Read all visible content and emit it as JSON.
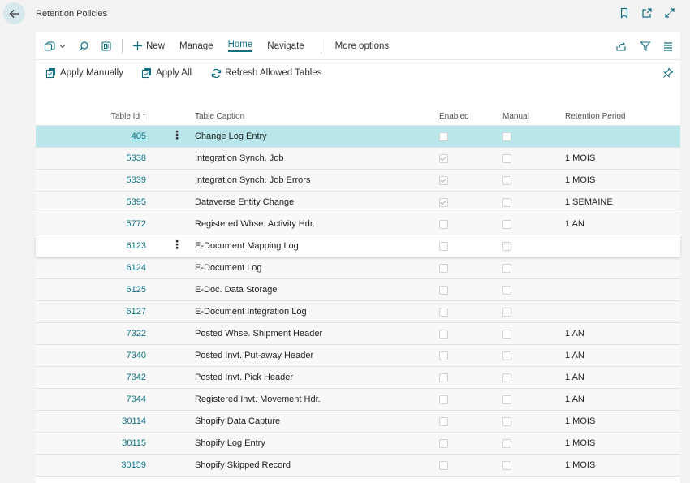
{
  "window": {
    "title": "Retention Policies"
  },
  "actions": {
    "new": "New",
    "manage": "Manage",
    "home": "Home",
    "navigate": "Navigate",
    "more": "More options"
  },
  "promoted": {
    "apply_manually": "Apply Manually",
    "apply_all": "Apply All",
    "refresh": "Refresh Allowed Tables"
  },
  "columns": {
    "table_id": "Table Id",
    "table_caption": "Table Caption",
    "enabled": "Enabled",
    "manual": "Manual",
    "retention_period": "Retention Period"
  },
  "rows": [
    {
      "id": "405",
      "caption": "Change Log Entry",
      "enabled": false,
      "manual": false,
      "period": "",
      "state": "selected"
    },
    {
      "id": "5338",
      "caption": "Integration Synch. Job",
      "enabled": true,
      "manual": false,
      "period": "1 MOIS"
    },
    {
      "id": "5339",
      "caption": "Integration Synch. Job Errors",
      "enabled": true,
      "manual": false,
      "period": "1 MOIS"
    },
    {
      "id": "5395",
      "caption": "Dataverse Entity Change",
      "enabled": true,
      "manual": false,
      "period": "1 SEMAINE"
    },
    {
      "id": "5772",
      "caption": "Registered Whse. Activity Hdr.",
      "enabled": false,
      "manual": false,
      "period": "1 AN"
    },
    {
      "id": "6123",
      "caption": "E-Document Mapping Log",
      "enabled": false,
      "manual": false,
      "period": "",
      "state": "focus"
    },
    {
      "id": "6124",
      "caption": "E-Document Log",
      "enabled": false,
      "manual": false,
      "period": ""
    },
    {
      "id": "6125",
      "caption": "E-Doc. Data Storage",
      "enabled": false,
      "manual": false,
      "period": ""
    },
    {
      "id": "6127",
      "caption": "E-Document Integration Log",
      "enabled": false,
      "manual": false,
      "period": ""
    },
    {
      "id": "7322",
      "caption": "Posted Whse. Shipment Header",
      "enabled": false,
      "manual": false,
      "period": "1 AN"
    },
    {
      "id": "7340",
      "caption": "Posted Invt. Put-away Header",
      "enabled": false,
      "manual": false,
      "period": "1 AN"
    },
    {
      "id": "7342",
      "caption": "Posted Invt. Pick Header",
      "enabled": false,
      "manual": false,
      "period": "1 AN"
    },
    {
      "id": "7344",
      "caption": "Registered Invt. Movement Hdr.",
      "enabled": false,
      "manual": false,
      "period": "1 AN"
    },
    {
      "id": "30114",
      "caption": "Shopify Data Capture",
      "enabled": false,
      "manual": false,
      "period": "1 MOIS"
    },
    {
      "id": "30115",
      "caption": "Shopify Log Entry",
      "enabled": false,
      "manual": false,
      "period": "1 MOIS"
    },
    {
      "id": "30159",
      "caption": "Shopify Skipped Record",
      "enabled": false,
      "manual": false,
      "period": "1 MOIS"
    }
  ],
  "colors": {
    "accent": "#0f6f80",
    "selected_row": "#b8e6ea"
  }
}
